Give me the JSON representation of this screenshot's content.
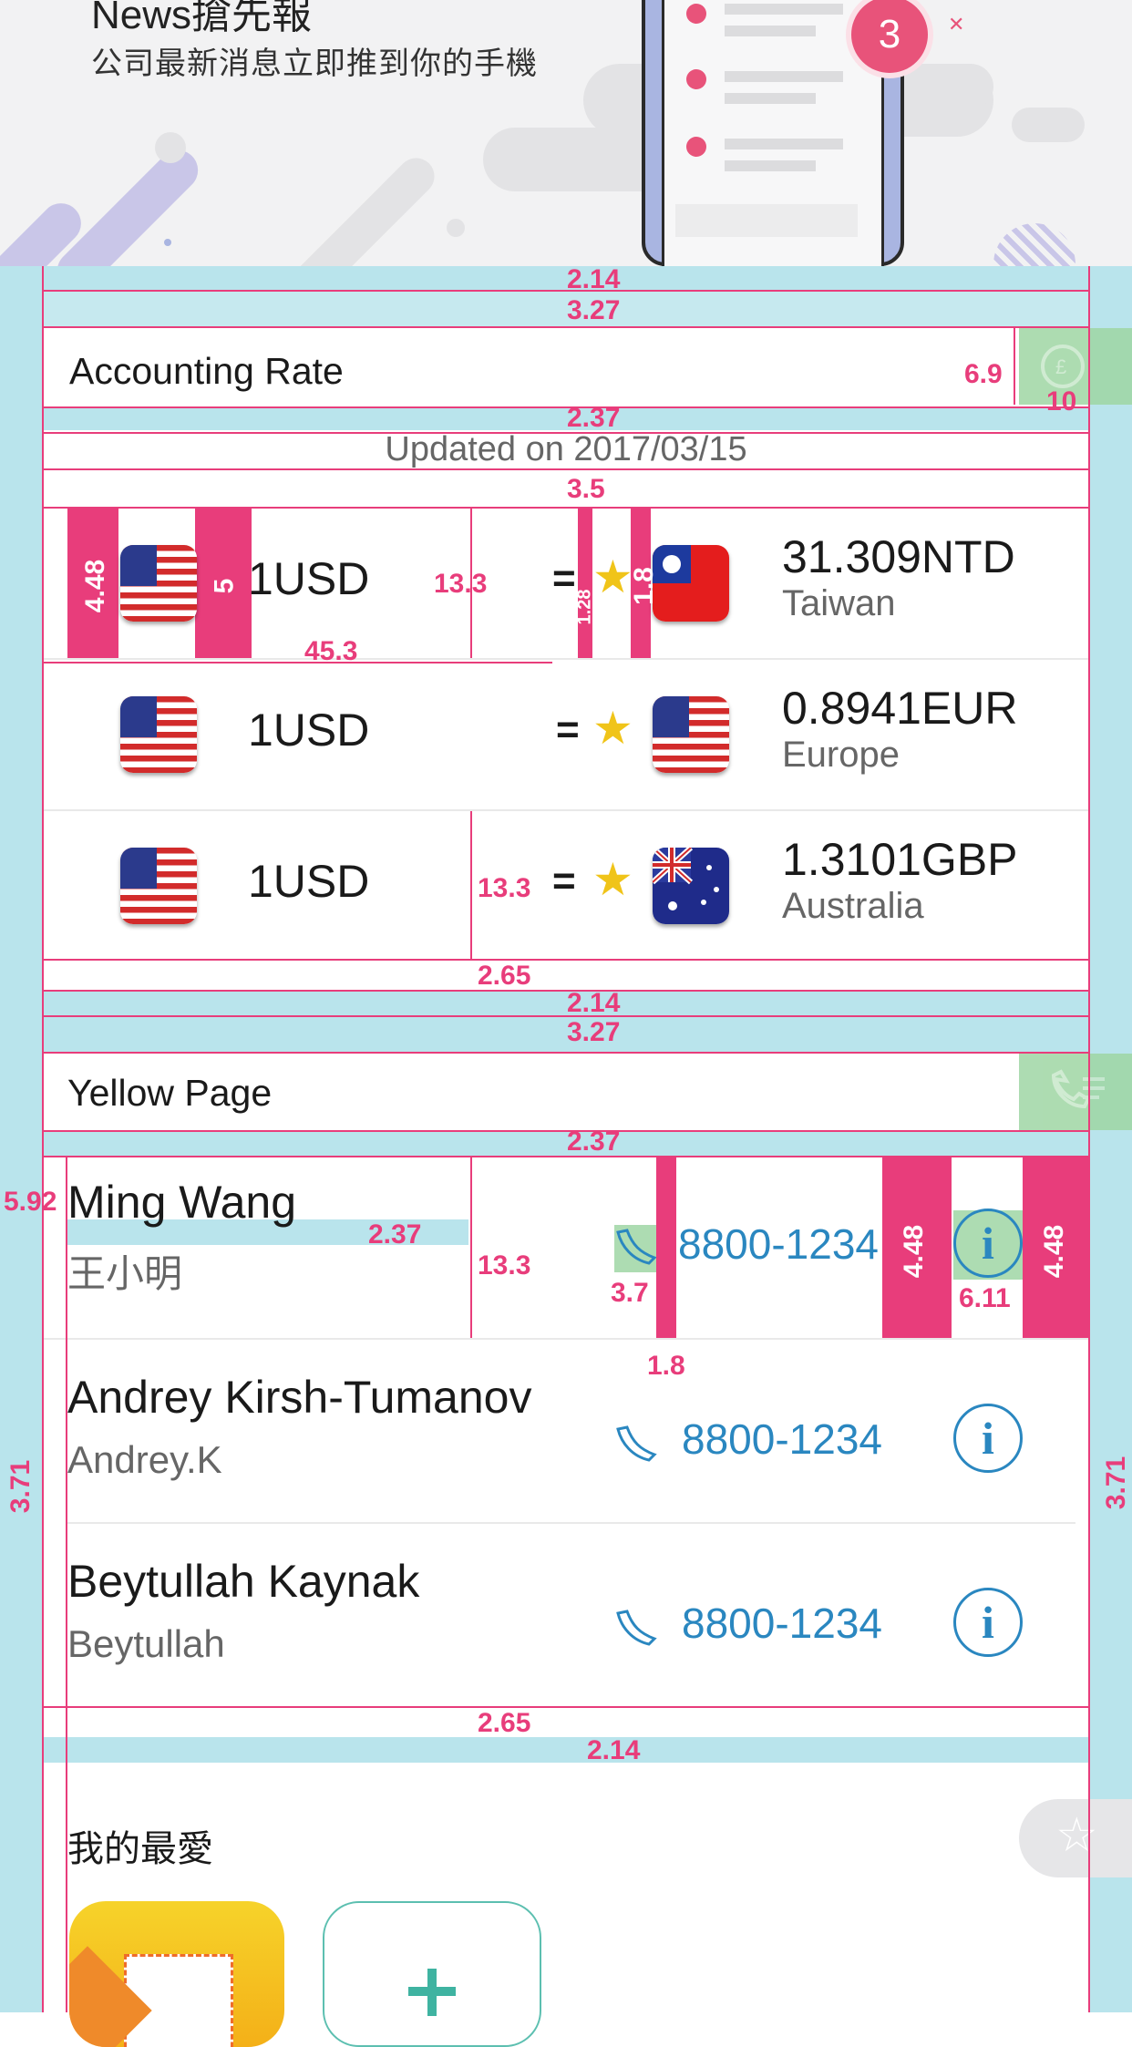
{
  "hero": {
    "title": "News搶先報",
    "subtitle": "公司最新消息立即推到你的手機",
    "badge_count": "3"
  },
  "accounting": {
    "title": "Accounting Rate",
    "updated": "Updated on 2017/03/15",
    "rows": [
      {
        "amount": "1USD",
        "equals": "=",
        "rate": "31.309NTD",
        "region": "Taiwan",
        "from_flag": "us-flag-icon",
        "to_flag": "taiwan-flag-icon"
      },
      {
        "amount": "1USD",
        "equals": "=",
        "rate": "0.8941EUR",
        "region": "Europe",
        "from_flag": "us-flag-icon",
        "to_flag": "us-flag-icon"
      },
      {
        "amount": "1USD",
        "equals": "=",
        "rate": "1.3101GBP",
        "region": "Australia",
        "from_flag": "us-flag-icon",
        "to_flag": "australia-flag-icon"
      }
    ]
  },
  "yellow_page": {
    "title": "Yellow Page",
    "contacts": [
      {
        "name": "Ming Wang",
        "alias": "王小明",
        "phone": "8800-1234"
      },
      {
        "name": "Andrey Kirsh-Tumanov",
        "alias": "Andrey.K",
        "phone": "8800-1234"
      },
      {
        "name": "Beytullah Kaynak",
        "alias": "Beytullah",
        "phone": "8800-1234"
      }
    ]
  },
  "favorites": {
    "title": "我的最愛"
  },
  "measurements": {
    "m_214_a": "2.14",
    "m_327_a": "3.27",
    "m_69": "6.9",
    "m_10": "10",
    "m_237_a": "2.37",
    "m_35": "3.5",
    "m_448_a": "4.48",
    "m_5": "5",
    "m_133_a": "13.3",
    "m_128": "1.28",
    "m_18_a": "1.8",
    "m_453": "45.3",
    "m_133_b": "13.3",
    "m_265_a": "2.65",
    "m_214_b": "2.14",
    "m_327_b": "3.27",
    "m_237_b": "2.37",
    "m_592": "5.92",
    "m_237_c": "2.37",
    "m_133_c": "13.3",
    "m_37": "3.7",
    "m_18_b": "1.8",
    "m_448_b": "4.48",
    "m_611": "6.11",
    "m_448_c": "4.48",
    "m_371_a": "3.71",
    "m_371_b": "3.71",
    "m_265_b": "2.65",
    "m_214_c": "2.14"
  },
  "colors": {
    "guide_pink": "#e83d7b",
    "guide_cyan": "#b9e4ec",
    "link_blue": "#2a87c0",
    "star_yellow": "#f0c419",
    "badge_pink": "#e8537a"
  }
}
